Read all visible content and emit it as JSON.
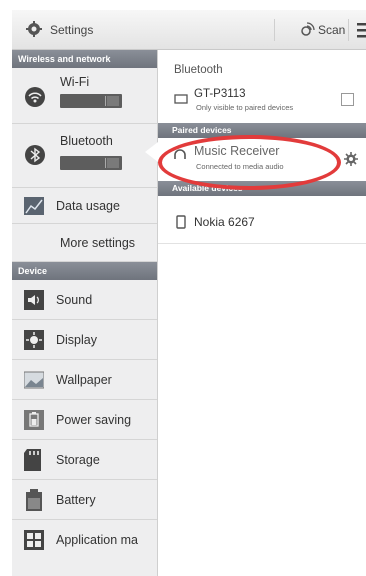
{
  "topbar": {
    "title": "Settings",
    "scan_label": "Scan"
  },
  "sidebar": {
    "sections": {
      "wireless": "Wireless and network",
      "device": "Device"
    },
    "items": {
      "wifi": "Wi-Fi",
      "bluetooth": "Bluetooth",
      "data_usage": "Data usage",
      "more": "More settings",
      "sound": "Sound",
      "display": "Display",
      "wallpaper": "Wallpaper",
      "power": "Power saving",
      "storage": "Storage",
      "battery": "Battery",
      "apps": "Application ma"
    }
  },
  "panel": {
    "title": "Bluetooth",
    "device": {
      "name": "GT-P3113",
      "sub": "Only visible to paired devices"
    },
    "paired_header": "Paired devices",
    "paired": [
      {
        "name": "Music Receiver",
        "sub": "Connected to media audio"
      }
    ],
    "available_header": "Available devices",
    "available": [
      {
        "name": "Nokia 6267"
      }
    ]
  },
  "colors": {
    "section_bg": "#7b8089",
    "annotation": "#e23b3b"
  }
}
